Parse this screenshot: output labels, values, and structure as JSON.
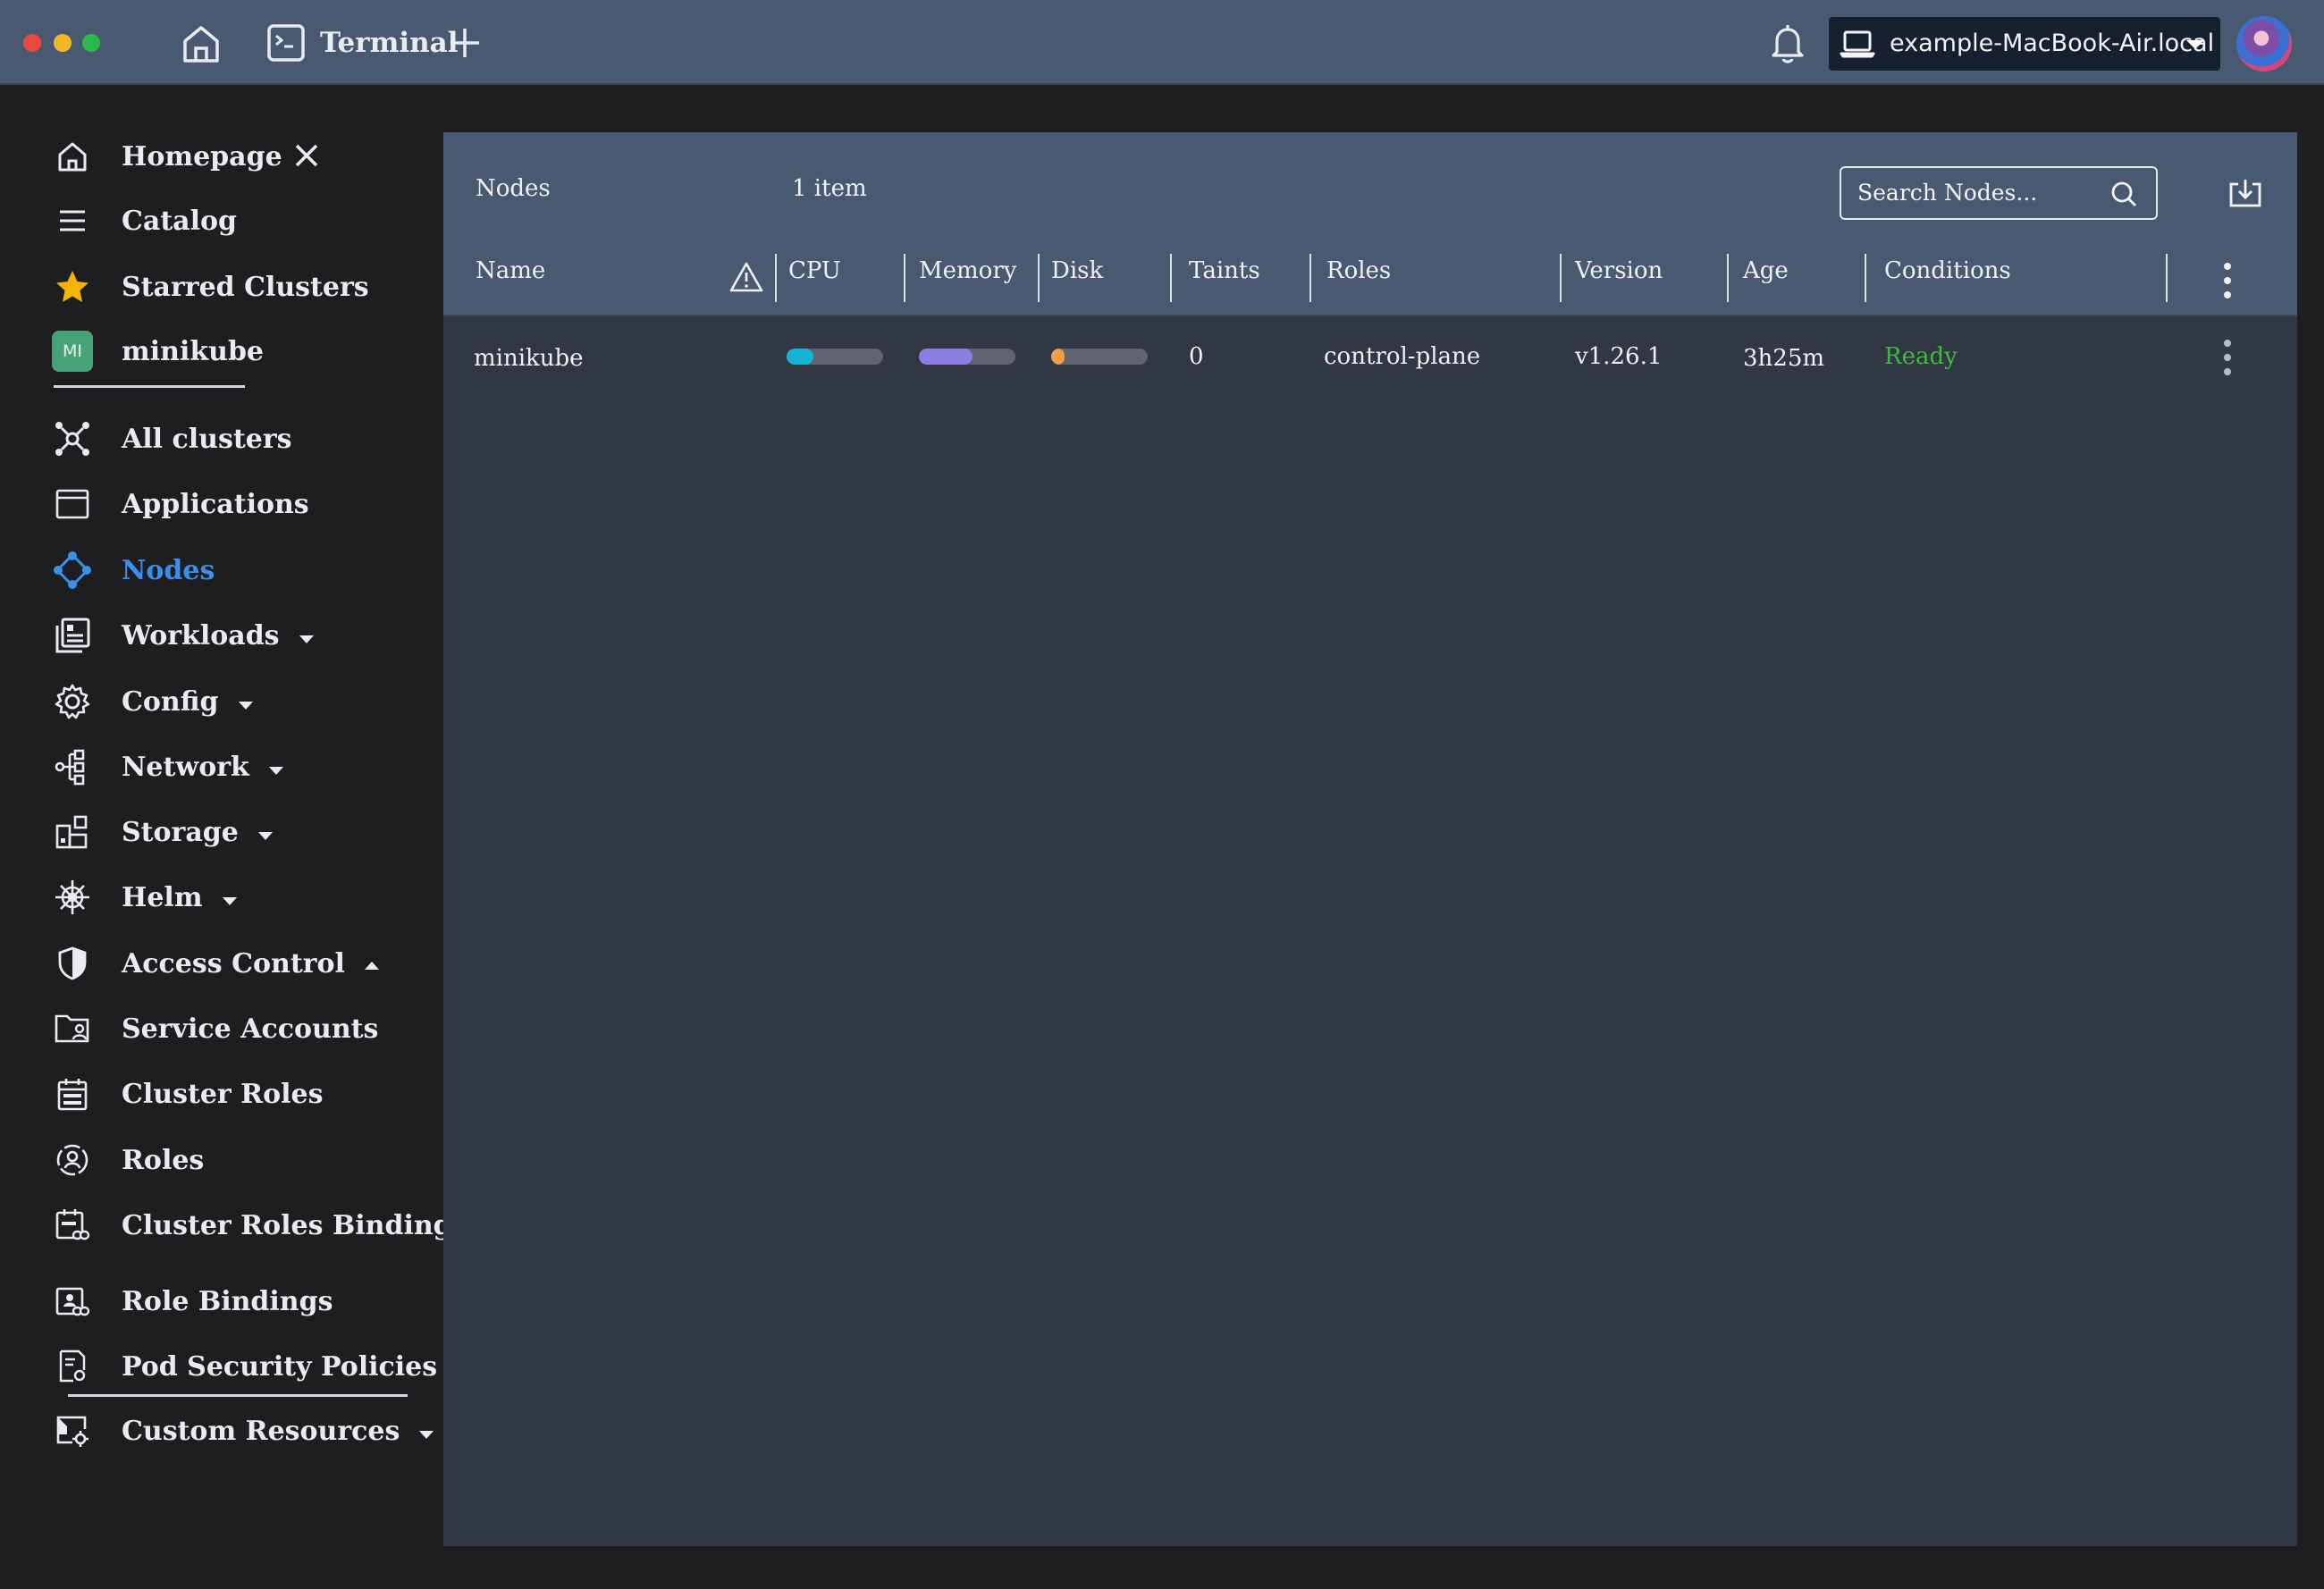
{
  "window": {
    "tab_label": "Terminal",
    "host": "example-MacBook-Air.local"
  },
  "sidebar": {
    "homepage": "Homepage",
    "catalog": "Catalog",
    "starred": "Starred Clusters",
    "cluster_badge": "MI",
    "cluster_name": "minikube",
    "items": {
      "all_clusters": "All clusters",
      "applications": "Applications",
      "nodes": "Nodes",
      "workloads": "Workloads",
      "config": "Config",
      "network": "Network",
      "storage": "Storage",
      "helm": "Helm",
      "access_control": "Access Control",
      "service_accounts": "Service Accounts",
      "cluster_roles": "Cluster Roles",
      "roles": "Roles",
      "cluster_roles_bindings": "Cluster Roles Bindings",
      "role_bindings": "Role Bindings",
      "pod_security_policies": "Pod Security Policies",
      "custom_resources": "Custom Resources"
    }
  },
  "nodes_panel": {
    "title": "Nodes",
    "count": "1 item",
    "search_placeholder": "Search Nodes...",
    "columns": {
      "name": "Name",
      "cpu": "CPU",
      "memory": "Memory",
      "disk": "Disk",
      "taints": "Taints",
      "roles": "Roles",
      "version": "Version",
      "age": "Age",
      "conditions": "Conditions"
    },
    "rows": [
      {
        "name": "minikube",
        "cpu_usage": 0.28,
        "memory_usage": 0.56,
        "disk_usage": 0.14,
        "taints": "0",
        "roles": "control-plane",
        "version": "v1.26.1",
        "age": "3h25m",
        "conditions": "Ready"
      }
    ]
  },
  "colors": {
    "accent": "#3c8fe8",
    "cpu_bar": "#16b3d6",
    "memory_bar": "#8e7fe2",
    "disk_bar": "#f0a04b",
    "ready": "#3cbc3c"
  }
}
